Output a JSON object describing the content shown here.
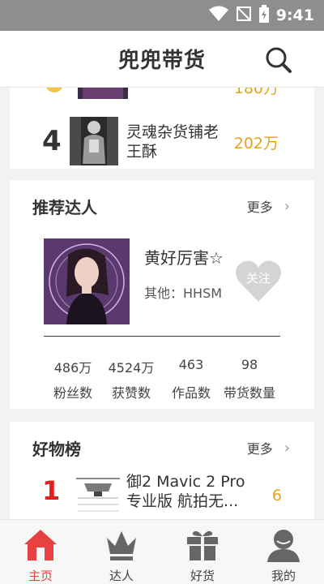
{
  "status": {
    "time": "9:41"
  },
  "header": {
    "title": "兜兜带货"
  },
  "ranking": {
    "partial": {
      "value": "180万"
    },
    "item4": {
      "rank": "4",
      "name": "灵魂杂货铺老王酥",
      "value": "202万"
    }
  },
  "talents": {
    "title": "推荐达人",
    "more": "更多",
    "name": "黄好厉害☆",
    "category": "其他：HHSM",
    "follow": "关注",
    "stats": [
      {
        "value": "486万",
        "label": "粉丝数"
      },
      {
        "value": "4524万",
        "label": "获赞数"
      },
      {
        "value": "463",
        "label": "作品数"
      },
      {
        "value": "98",
        "label": "带货数量"
      }
    ]
  },
  "goods": {
    "title": "好物榜",
    "more": "更多",
    "item1": {
      "rank": "1",
      "name": "御2 Mavic 2 Pro专业版 航拍无...",
      "value": "6"
    }
  },
  "tabs": [
    {
      "label": "主页",
      "icon": "home-icon"
    },
    {
      "label": "达人",
      "icon": "crown-icon"
    },
    {
      "label": "好货",
      "icon": "gift-icon"
    },
    {
      "label": "我的",
      "icon": "user-icon"
    }
  ],
  "colors": {
    "accent": "#e84141",
    "value": "#e8a21a",
    "rankRed": "#e02020",
    "statusbar": "#8e8e8e"
  }
}
